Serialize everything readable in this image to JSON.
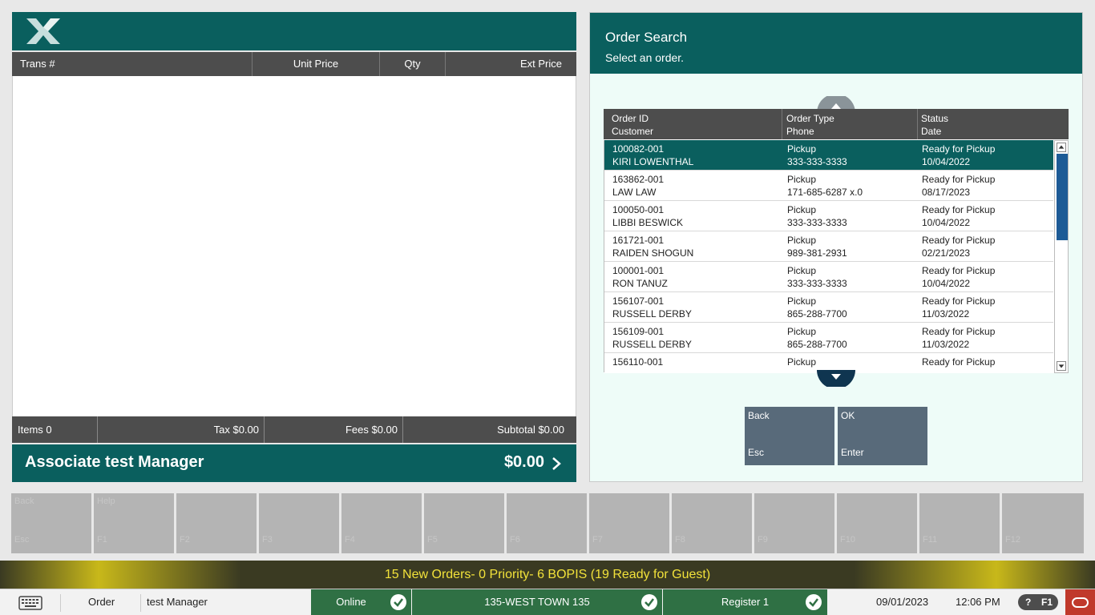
{
  "transaction": {
    "columns": [
      "Trans #",
      "Unit Price",
      "Qty",
      "Ext Price"
    ],
    "items_label": "Items 0",
    "tax_label": "Tax $0.00",
    "fees_label": "Fees $0.00",
    "subtotal_label": "Subtotal $0.00",
    "associate": "Associate test Manager",
    "total": "$0.00"
  },
  "order_search": {
    "title": "Order Search",
    "subtitle": "Select an order.",
    "headers": {
      "c1_line1": "Order ID",
      "c1_line2": "Customer",
      "c2_line1": "Order Type",
      "c2_line2": "Phone",
      "c3_line1": "Status",
      "c3_line2": "Date"
    },
    "rows": [
      {
        "id": "100082-001",
        "customer": "KIRI LOWENTHAL",
        "type": "Pickup",
        "phone": "333-333-3333",
        "status": "Ready for Pickup",
        "date": "10/04/2022",
        "selected": true
      },
      {
        "id": "163862-001",
        "customer": "LAW LAW",
        "type": "Pickup",
        "phone": "171-685-6287 x.0",
        "status": "Ready for Pickup",
        "date": "08/17/2023"
      },
      {
        "id": "100050-001",
        "customer": "LIBBI BESWICK",
        "type": "Pickup",
        "phone": "333-333-3333",
        "status": "Ready for Pickup",
        "date": "10/04/2022"
      },
      {
        "id": "161721-001",
        "customer": "RAIDEN SHOGUN",
        "type": "Pickup",
        "phone": "989-381-2931",
        "status": "Ready for Pickup",
        "date": "02/21/2023"
      },
      {
        "id": "100001-001",
        "customer": "RON TANUZ",
        "type": "Pickup",
        "phone": "333-333-3333",
        "status": "Ready for Pickup",
        "date": "10/04/2022"
      },
      {
        "id": "156107-001",
        "customer": "RUSSELL DERBY",
        "type": "Pickup",
        "phone": "865-288-7700",
        "status": "Ready for Pickup",
        "date": "11/03/2022"
      },
      {
        "id": "156109-001",
        "customer": "RUSSELL DERBY",
        "type": "Pickup",
        "phone": "865-288-7700",
        "status": "Ready for Pickup",
        "date": "11/03/2022"
      },
      {
        "id": "156110-001",
        "customer": "",
        "type": "Pickup",
        "phone": "",
        "status": "Ready for Pickup",
        "date": ""
      }
    ],
    "back_button": {
      "label": "Back",
      "key": "Esc"
    },
    "ok_button": {
      "label": "OK",
      "key": "Enter"
    }
  },
  "function_keys": [
    {
      "label": "Back",
      "key": "Esc"
    },
    {
      "label": "Help",
      "key": "F1"
    },
    {
      "label": "",
      "key": "F2"
    },
    {
      "label": "",
      "key": "F3"
    },
    {
      "label": "",
      "key": "F4"
    },
    {
      "label": "",
      "key": "F5"
    },
    {
      "label": "",
      "key": "F6"
    },
    {
      "label": "",
      "key": "F7"
    },
    {
      "label": "",
      "key": "F8"
    },
    {
      "label": "",
      "key": "F9"
    },
    {
      "label": "",
      "key": "F10"
    },
    {
      "label": "",
      "key": "F11"
    },
    {
      "label": "",
      "key": "F12"
    }
  ],
  "notification": "15 New Orders- 0 Priority- 6 BOPIS (19 Ready for Guest)",
  "status_bar": {
    "mode": "Order",
    "user": "test Manager",
    "online": "Online",
    "store": "135-WEST TOWN 135",
    "register": "Register 1",
    "date": "09/01/2023",
    "time": "12:06 PM",
    "help_q": "?",
    "help_key": "F1"
  },
  "colors": {
    "brand_teal": "#0a5f5e",
    "header_gray": "#4d4d4d",
    "status_green": "#2f7044",
    "notif_yellow": "#f2e23a",
    "button_slate": "#586a7a"
  }
}
